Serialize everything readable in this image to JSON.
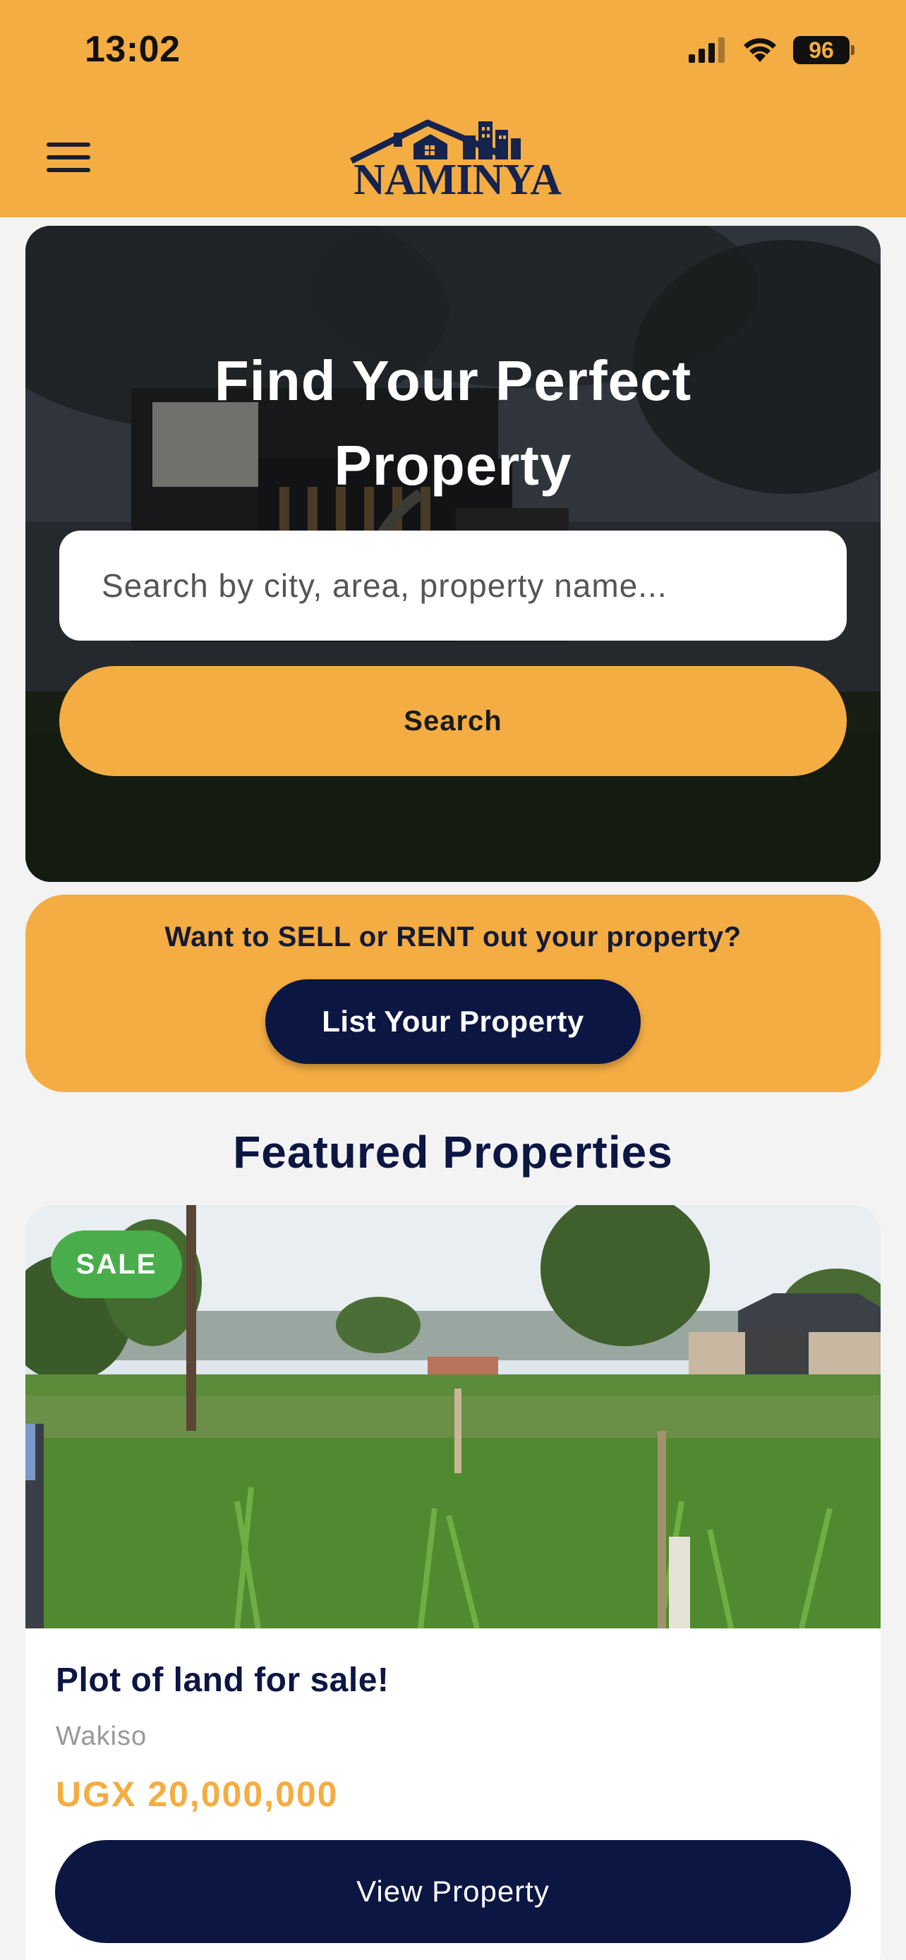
{
  "status_bar": {
    "time": "13:02",
    "battery": "96"
  },
  "header": {
    "logo_text": "NAMINYA"
  },
  "hero": {
    "title_line1": "Find Your Perfect",
    "title_line2": "Property",
    "search_placeholder": "Search by city, area, property name...",
    "search_button": "Search"
  },
  "list_cta": {
    "text": "Want to SELL or RENT out your property?",
    "button": "List Your Property"
  },
  "featured": {
    "title": "Featured Properties",
    "items": [
      {
        "badge": "SALE",
        "title": "Plot of land for sale!",
        "location": "Wakiso",
        "price": "UGX 20,000,000",
        "button": "View Property"
      }
    ]
  },
  "colors": {
    "accent": "#f4ad43",
    "navy": "#0c1642",
    "sale_badge": "#4aad4c"
  },
  "icons": [
    "menu-icon",
    "signal-icon",
    "wifi-icon",
    "battery-icon",
    "logo-house-icon"
  ]
}
